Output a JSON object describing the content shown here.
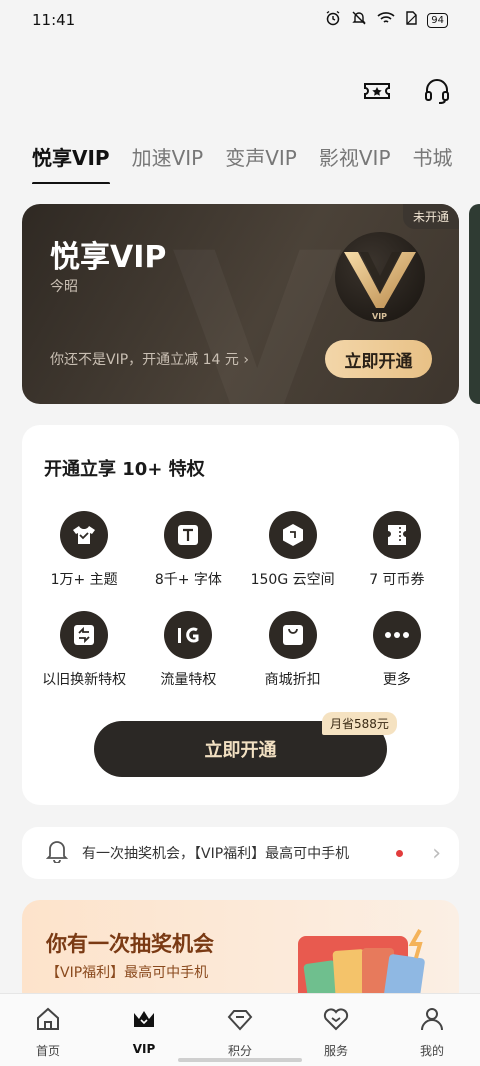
{
  "status_bar": {
    "time": "11:41",
    "battery": "94"
  },
  "header": {
    "icons": [
      "ticket-star-icon",
      "headset-icon"
    ]
  },
  "tabs": [
    {
      "label": "悦享VIP",
      "active": true
    },
    {
      "label": "加速VIP"
    },
    {
      "label": "变声VIP"
    },
    {
      "label": "影视VIP"
    },
    {
      "label": "书城"
    }
  ],
  "vip_card": {
    "badge": "未开通",
    "title": "悦享VIP",
    "user": "今昭",
    "promo": "你还不是VIP，开通立减 14 元",
    "logo_label": "VIP",
    "button": "立即开通"
  },
  "privileges": {
    "title": "开通立享 10+ 特权",
    "items": [
      {
        "label": "1万+ 主题",
        "icon": "tshirt-icon"
      },
      {
        "label": "8千+ 字体",
        "icon": "font-icon"
      },
      {
        "label": "150G 云空间",
        "icon": "cloud-box-icon"
      },
      {
        "label": "7 可币券",
        "icon": "coupon-icon"
      },
      {
        "label": "以旧换新特权",
        "icon": "trade-in-icon"
      },
      {
        "label": "流量特权",
        "icon": "data-1g-icon"
      },
      {
        "label": "商城折扣",
        "icon": "shopping-bag-icon"
      },
      {
        "label": "更多",
        "icon": "more-icon"
      }
    ],
    "save_tag": "月省588元",
    "button": "立即开通"
  },
  "notice": {
    "text": "有一次抽奖机会，【VIP福利】最高可中手机"
  },
  "lottery": {
    "title": "你有一次抽奖机会",
    "subtitle": "【VIP福利】最高可中手机"
  },
  "bottom_nav": [
    {
      "label": "首页",
      "icon": "home-icon"
    },
    {
      "label": "VIP",
      "icon": "crown-icon",
      "active": true
    },
    {
      "label": "积分",
      "icon": "diamond-icon"
    },
    {
      "label": "服务",
      "icon": "heart-service-icon"
    },
    {
      "label": "我的",
      "icon": "person-icon"
    }
  ]
}
